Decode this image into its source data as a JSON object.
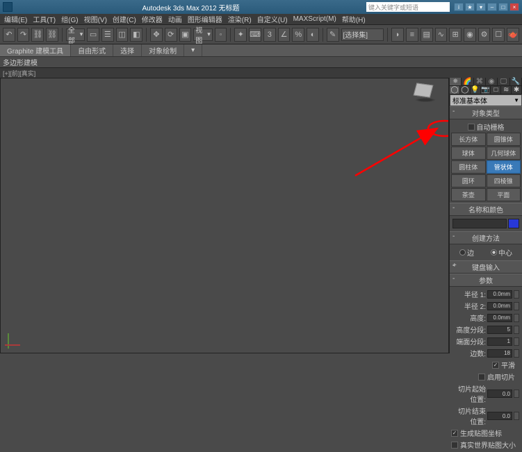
{
  "titlebar": {
    "title": "Autodesk 3ds Max 2012      无标题",
    "search_placeholder": "键入关键字或短语"
  },
  "menu": {
    "items": [
      "编辑(E)",
      "工具(T)",
      "组(G)",
      "视图(V)",
      "创建(C)",
      "修改器",
      "动画",
      "图形编辑器",
      "渲染(R)",
      "自定义(U)",
      "MAXScript(M)",
      "帮助(H)"
    ]
  },
  "toolbar": {
    "selection_filter": "全部",
    "view_mode": "视图",
    "named_selection": "[选择集]"
  },
  "ribbon": {
    "tabs": [
      "Graphite 建模工具",
      "自由形式",
      "选择",
      "对象绘制"
    ]
  },
  "subribbon": {
    "label": "多边形建模"
  },
  "viewport": {
    "label": "[+][前][真实]"
  },
  "panel": {
    "category": "标准基本体",
    "rollouts": {
      "objectType": "对象类型",
      "autoGrid": "自动栅格",
      "nameColor": "名称和颜色",
      "createMethod": "创建方法",
      "keyboardEntry": "键盘输入",
      "params": "参数"
    },
    "primitives": [
      {
        "l": "长方体",
        "r": "圆锥体"
      },
      {
        "l": "球体",
        "r": "几何球体"
      },
      {
        "l": "圆柱体",
        "r": "管状体"
      },
      {
        "l": "圆环",
        "r": "四棱锥"
      },
      {
        "l": "茶壶",
        "r": "平面"
      }
    ],
    "createMethod": {
      "edge": "边",
      "center": "中心"
    },
    "params": {
      "radius1": {
        "label": "半径 1:",
        "value": "0.0mm"
      },
      "radius2": {
        "label": "半径 2:",
        "value": "0.0mm"
      },
      "height": {
        "label": "高度:",
        "value": "0.0mm"
      },
      "heightSegs": {
        "label": "高度分段:",
        "value": "5"
      },
      "capSegs": {
        "label": "端面分段:",
        "value": "1"
      },
      "sides": {
        "label": "边数:",
        "value": "18"
      },
      "smooth": "平滑",
      "sliceOn": "启用切片",
      "sliceFrom": {
        "label": "切片起始位置:",
        "value": "0.0"
      },
      "sliceTo": {
        "label": "切片结束位置:",
        "value": "0.0"
      },
      "genMapCoords": "生成贴图坐标",
      "realWorldMap": "真实世界贴图大小"
    }
  }
}
